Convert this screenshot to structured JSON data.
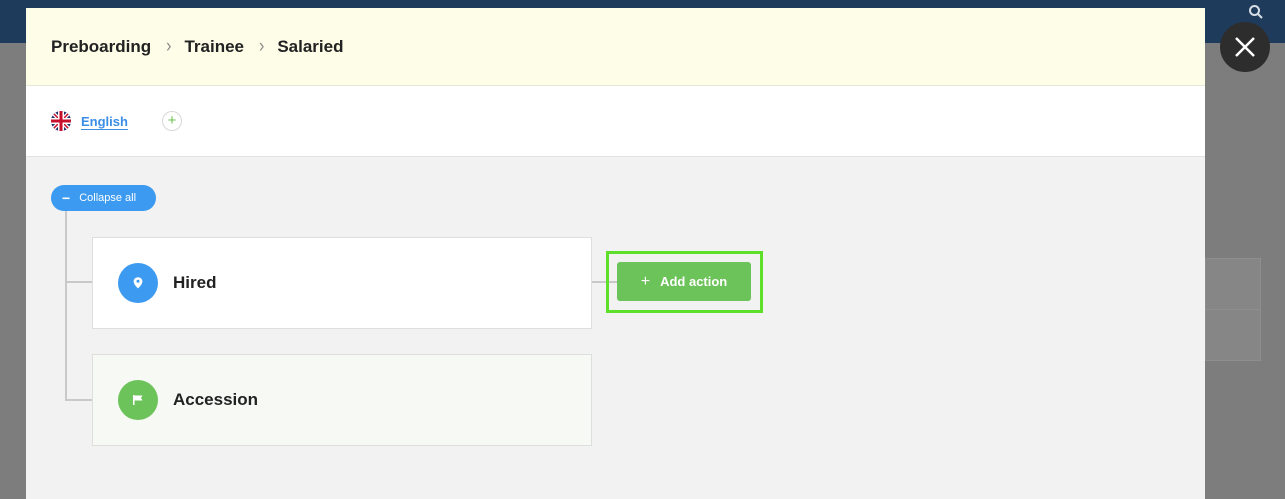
{
  "breadcrumb": {
    "items": [
      "Preboarding",
      "Trainee",
      "Salaried"
    ],
    "separator": "›"
  },
  "language": {
    "current": "English",
    "add_symbol": "+",
    "flag_icon": "uk-flag-icon"
  },
  "toolbar": {
    "collapse_all_label": "Collapse all",
    "collapse_symbol": "−"
  },
  "stages": [
    {
      "label": "Hired",
      "icon": "location-pin-icon",
      "icon_color": "#3c9af0",
      "background": "#ffffff"
    },
    {
      "label": "Accession",
      "icon": "flag-icon",
      "icon_color": "#6cc35a",
      "background": "#f6f9f4"
    }
  ],
  "add_action": {
    "label": "Add action",
    "symbol": "+"
  },
  "colors": {
    "accent_blue": "#3c9af0",
    "accent_green": "#6cc35a",
    "highlight": "#5ee02a",
    "header_bg": "#fdfde8"
  }
}
